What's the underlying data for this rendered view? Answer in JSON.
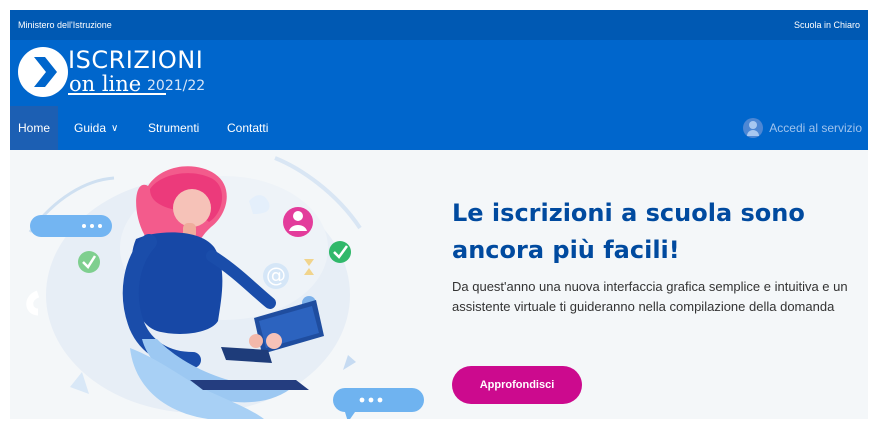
{
  "topbar": {
    "left": "Ministero dell'Istruzione",
    "right": "Scuola in Chiaro"
  },
  "brand": {
    "title": "ISCRIZIONI",
    "subtitle": "on line",
    "year": "2021/22"
  },
  "nav": {
    "items": [
      {
        "label": "Home"
      },
      {
        "label": "Guida"
      },
      {
        "label": "Strumenti"
      },
      {
        "label": "Contatti"
      }
    ],
    "login": "Accedi al servizio"
  },
  "hero": {
    "title_line1": "Le iscrizioni a scuola sono",
    "title_line2": "ancora più facili!",
    "description": "Da quest'anno una nuova interfaccia grafica semplice e intuitiva e un assistente virtuale ti guideranno nella compilazione della domanda",
    "cta": "Approfondisci"
  },
  "colors": {
    "header": "#0066cc",
    "topbar": "#0059b3",
    "accent": "#cc0a8e",
    "title": "#004a9f"
  }
}
